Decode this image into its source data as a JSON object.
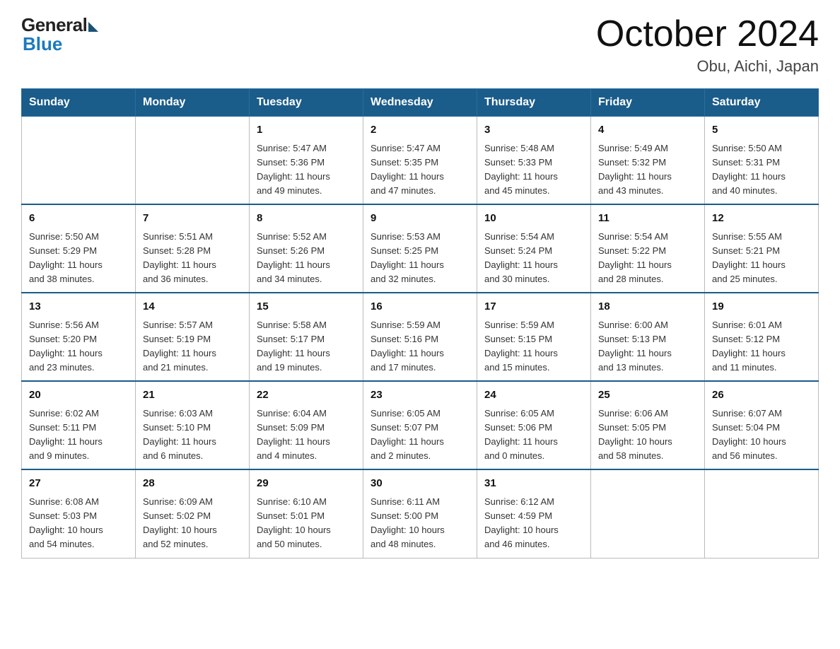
{
  "logo": {
    "general": "General",
    "blue": "Blue"
  },
  "title": "October 2024",
  "location": "Obu, Aichi, Japan",
  "weekdays": [
    "Sunday",
    "Monday",
    "Tuesday",
    "Wednesday",
    "Thursday",
    "Friday",
    "Saturday"
  ],
  "weeks": [
    [
      {
        "day": "",
        "info": ""
      },
      {
        "day": "",
        "info": ""
      },
      {
        "day": "1",
        "info": "Sunrise: 5:47 AM\nSunset: 5:36 PM\nDaylight: 11 hours\nand 49 minutes."
      },
      {
        "day": "2",
        "info": "Sunrise: 5:47 AM\nSunset: 5:35 PM\nDaylight: 11 hours\nand 47 minutes."
      },
      {
        "day": "3",
        "info": "Sunrise: 5:48 AM\nSunset: 5:33 PM\nDaylight: 11 hours\nand 45 minutes."
      },
      {
        "day": "4",
        "info": "Sunrise: 5:49 AM\nSunset: 5:32 PM\nDaylight: 11 hours\nand 43 minutes."
      },
      {
        "day": "5",
        "info": "Sunrise: 5:50 AM\nSunset: 5:31 PM\nDaylight: 11 hours\nand 40 minutes."
      }
    ],
    [
      {
        "day": "6",
        "info": "Sunrise: 5:50 AM\nSunset: 5:29 PM\nDaylight: 11 hours\nand 38 minutes."
      },
      {
        "day": "7",
        "info": "Sunrise: 5:51 AM\nSunset: 5:28 PM\nDaylight: 11 hours\nand 36 minutes."
      },
      {
        "day": "8",
        "info": "Sunrise: 5:52 AM\nSunset: 5:26 PM\nDaylight: 11 hours\nand 34 minutes."
      },
      {
        "day": "9",
        "info": "Sunrise: 5:53 AM\nSunset: 5:25 PM\nDaylight: 11 hours\nand 32 minutes."
      },
      {
        "day": "10",
        "info": "Sunrise: 5:54 AM\nSunset: 5:24 PM\nDaylight: 11 hours\nand 30 minutes."
      },
      {
        "day": "11",
        "info": "Sunrise: 5:54 AM\nSunset: 5:22 PM\nDaylight: 11 hours\nand 28 minutes."
      },
      {
        "day": "12",
        "info": "Sunrise: 5:55 AM\nSunset: 5:21 PM\nDaylight: 11 hours\nand 25 minutes."
      }
    ],
    [
      {
        "day": "13",
        "info": "Sunrise: 5:56 AM\nSunset: 5:20 PM\nDaylight: 11 hours\nand 23 minutes."
      },
      {
        "day": "14",
        "info": "Sunrise: 5:57 AM\nSunset: 5:19 PM\nDaylight: 11 hours\nand 21 minutes."
      },
      {
        "day": "15",
        "info": "Sunrise: 5:58 AM\nSunset: 5:17 PM\nDaylight: 11 hours\nand 19 minutes."
      },
      {
        "day": "16",
        "info": "Sunrise: 5:59 AM\nSunset: 5:16 PM\nDaylight: 11 hours\nand 17 minutes."
      },
      {
        "day": "17",
        "info": "Sunrise: 5:59 AM\nSunset: 5:15 PM\nDaylight: 11 hours\nand 15 minutes."
      },
      {
        "day": "18",
        "info": "Sunrise: 6:00 AM\nSunset: 5:13 PM\nDaylight: 11 hours\nand 13 minutes."
      },
      {
        "day": "19",
        "info": "Sunrise: 6:01 AM\nSunset: 5:12 PM\nDaylight: 11 hours\nand 11 minutes."
      }
    ],
    [
      {
        "day": "20",
        "info": "Sunrise: 6:02 AM\nSunset: 5:11 PM\nDaylight: 11 hours\nand 9 minutes."
      },
      {
        "day": "21",
        "info": "Sunrise: 6:03 AM\nSunset: 5:10 PM\nDaylight: 11 hours\nand 6 minutes."
      },
      {
        "day": "22",
        "info": "Sunrise: 6:04 AM\nSunset: 5:09 PM\nDaylight: 11 hours\nand 4 minutes."
      },
      {
        "day": "23",
        "info": "Sunrise: 6:05 AM\nSunset: 5:07 PM\nDaylight: 11 hours\nand 2 minutes."
      },
      {
        "day": "24",
        "info": "Sunrise: 6:05 AM\nSunset: 5:06 PM\nDaylight: 11 hours\nand 0 minutes."
      },
      {
        "day": "25",
        "info": "Sunrise: 6:06 AM\nSunset: 5:05 PM\nDaylight: 10 hours\nand 58 minutes."
      },
      {
        "day": "26",
        "info": "Sunrise: 6:07 AM\nSunset: 5:04 PM\nDaylight: 10 hours\nand 56 minutes."
      }
    ],
    [
      {
        "day": "27",
        "info": "Sunrise: 6:08 AM\nSunset: 5:03 PM\nDaylight: 10 hours\nand 54 minutes."
      },
      {
        "day": "28",
        "info": "Sunrise: 6:09 AM\nSunset: 5:02 PM\nDaylight: 10 hours\nand 52 minutes."
      },
      {
        "day": "29",
        "info": "Sunrise: 6:10 AM\nSunset: 5:01 PM\nDaylight: 10 hours\nand 50 minutes."
      },
      {
        "day": "30",
        "info": "Sunrise: 6:11 AM\nSunset: 5:00 PM\nDaylight: 10 hours\nand 48 minutes."
      },
      {
        "day": "31",
        "info": "Sunrise: 6:12 AM\nSunset: 4:59 PM\nDaylight: 10 hours\nand 46 minutes."
      },
      {
        "day": "",
        "info": ""
      },
      {
        "day": "",
        "info": ""
      }
    ]
  ]
}
